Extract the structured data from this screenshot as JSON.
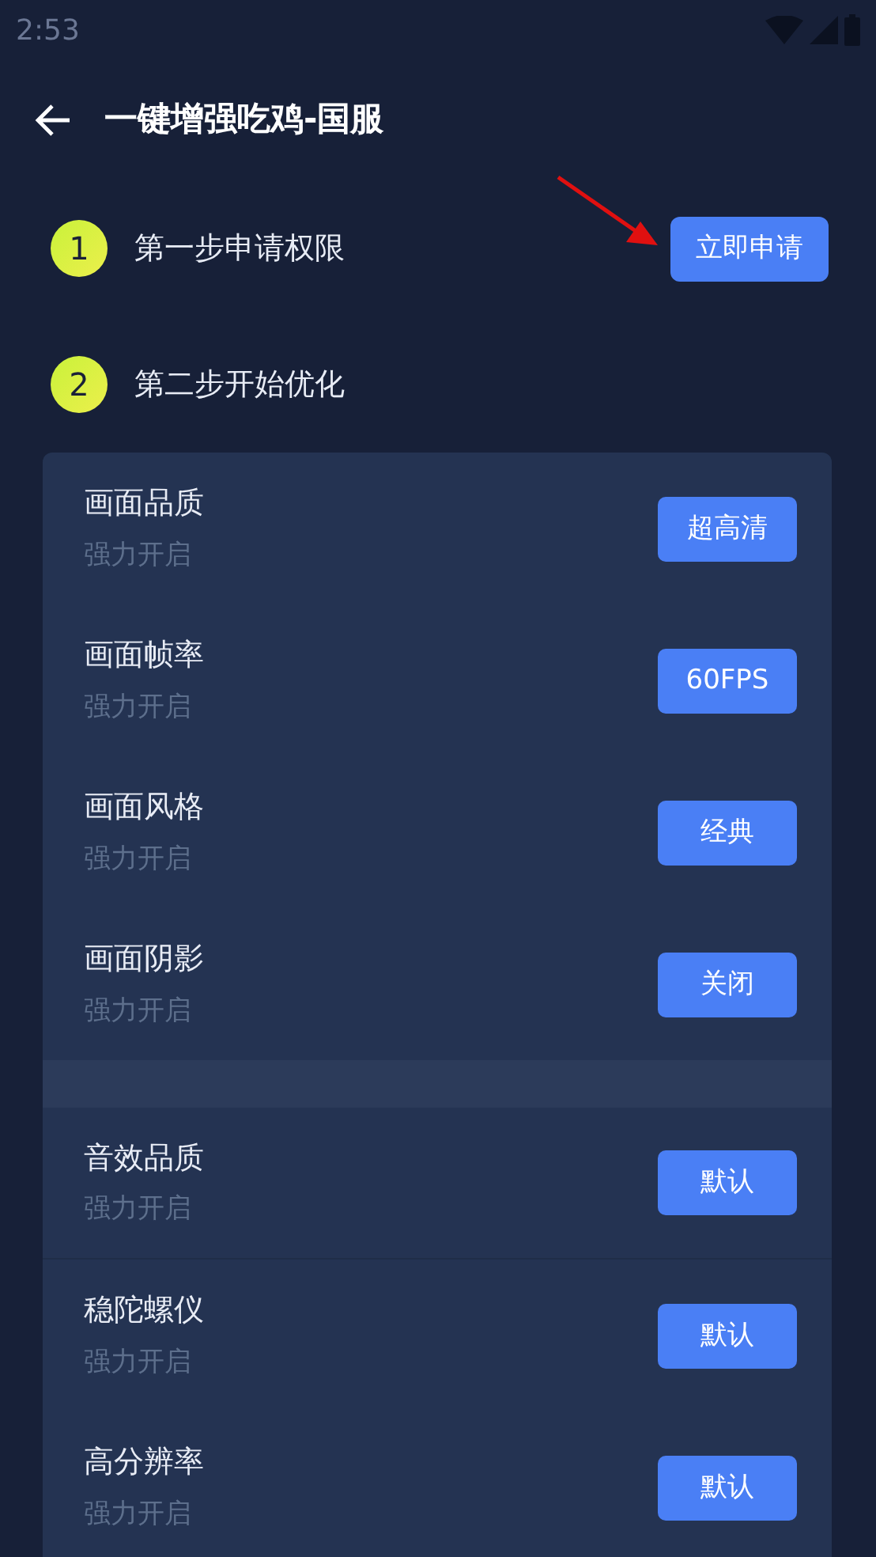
{
  "status_bar": {
    "time": "2:53"
  },
  "app_bar": {
    "title": "一键增强吃鸡-国服"
  },
  "steps": [
    {
      "number": "1",
      "label": "第一步申请权限",
      "button": "立即申请"
    },
    {
      "number": "2",
      "label": "第二步开始优化"
    }
  ],
  "groups": [
    {
      "items": [
        {
          "title": "画面品质",
          "subtitle": "强力开启",
          "button": "超高清"
        },
        {
          "title": "画面帧率",
          "subtitle": "强力开启",
          "button": "60FPS"
        },
        {
          "title": "画面风格",
          "subtitle": "强力开启",
          "button": "经典"
        },
        {
          "title": "画面阴影",
          "subtitle": "强力开启",
          "button": "关闭"
        }
      ]
    },
    {
      "items": [
        {
          "title": "音效品质",
          "subtitle": "强力开启",
          "button": "默认"
        },
        {
          "title": "稳陀螺仪",
          "subtitle": "强力开启",
          "button": "默认"
        },
        {
          "title": "高分辨率",
          "subtitle": "强力开启",
          "button": "默认"
        }
      ]
    }
  ]
}
